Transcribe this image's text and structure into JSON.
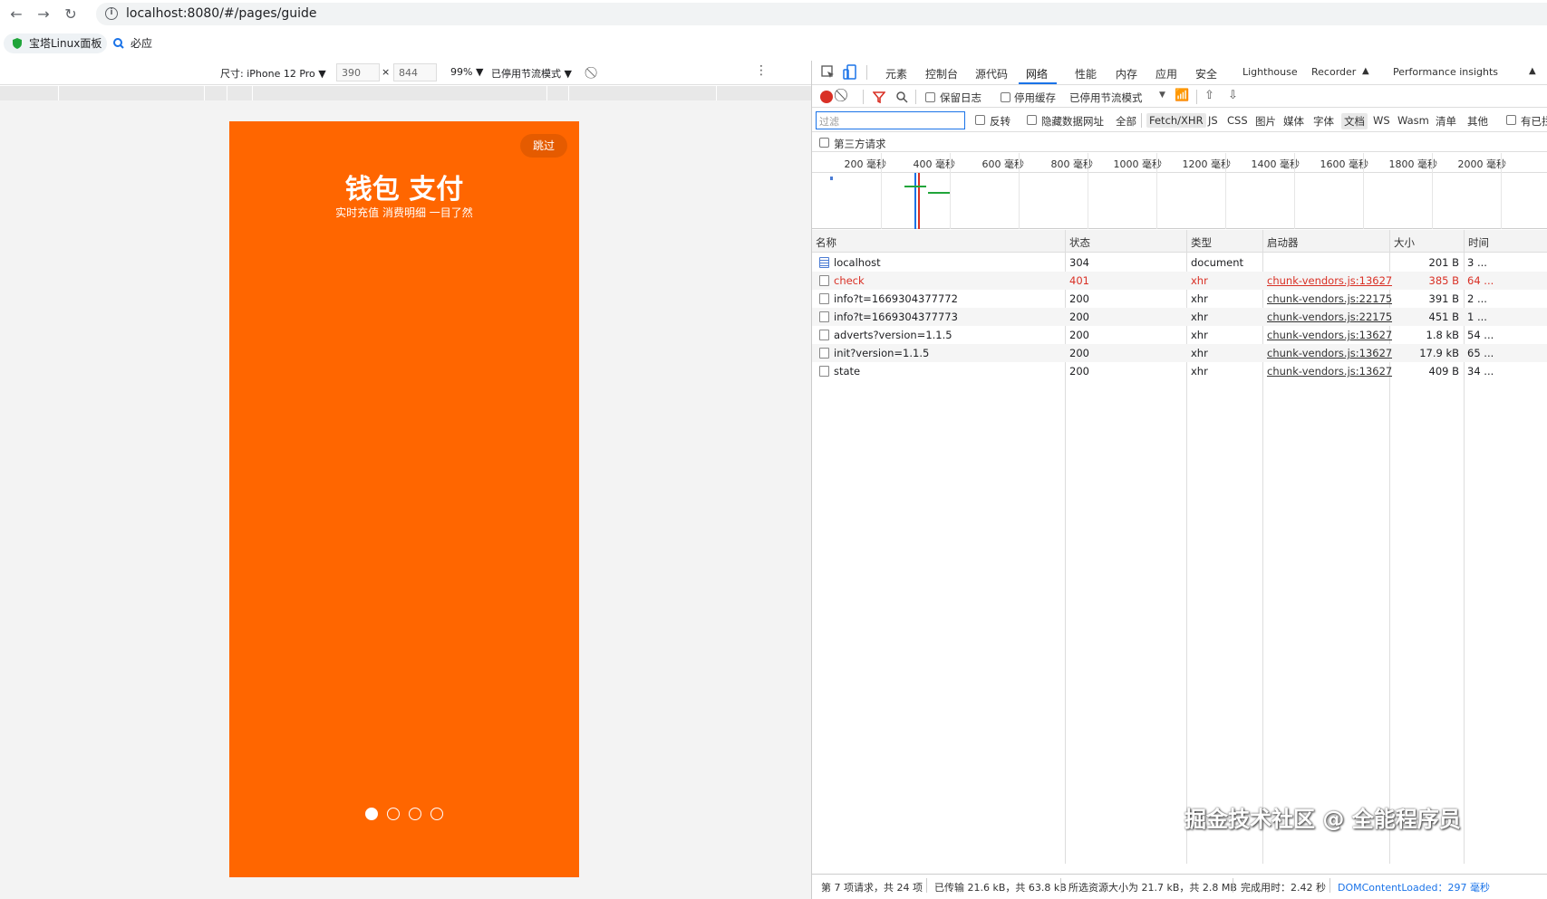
{
  "browser": {
    "url": "localhost:8080/#/pages/guide",
    "bookmarks": [
      {
        "label": "宝塔Linux面板"
      },
      {
        "label": "必应"
      }
    ]
  },
  "device_toolbar": {
    "dimensions_label": "尺寸: iPhone 12 Pro ▼",
    "width_value": "390",
    "times": "×",
    "height_value": "844",
    "zoom": "99% ▼",
    "throttle": "已停用节流模式 ▼"
  },
  "app": {
    "skip_label": "跳过",
    "title": "钱包 支付",
    "subtitle": "实时充值 消费明细 一目了然",
    "dots_total": 4,
    "dots_active_index": 0
  },
  "devtools": {
    "tabs": [
      "元素",
      "控制台",
      "源代码",
      "网络",
      "性能",
      "内存",
      "应用",
      "安全",
      "Lighthouse",
      "Recorder",
      "Performance insights"
    ],
    "active_tab": "网络",
    "network_toolbar": {
      "preserve_log": "保留日志",
      "disable_cache": "停用缓存",
      "throttle": "已停用节流模式"
    },
    "filter": {
      "placeholder": "过滤",
      "invert": "反转",
      "hide_data_urls": "隐藏数据网址",
      "types": [
        "全部",
        "Fetch/XHR",
        "JS",
        "CSS",
        "图片",
        "媒体",
        "字体",
        "文档",
        "WS",
        "Wasm",
        "清单",
        "其他"
      ],
      "blocked_cookies": "有已拦",
      "third_party": "第三方请求"
    },
    "timeline_ticks": [
      "200 毫秒",
      "400 毫秒",
      "600 毫秒",
      "800 毫秒",
      "1000 毫秒",
      "1200 毫秒",
      "1400 毫秒",
      "1600 毫秒",
      "1800 毫秒",
      "2000 毫秒"
    ],
    "columns": [
      "名称",
      "状态",
      "类型",
      "启动器",
      "大小",
      "时间"
    ],
    "rows": [
      {
        "name": "localhost",
        "status": "304",
        "type": "document",
        "initiator": "",
        "size": "201 B",
        "time": "3 ...",
        "error": false,
        "doc": true
      },
      {
        "name": "check",
        "status": "401",
        "type": "xhr",
        "initiator": "chunk-vendors.js:13627",
        "size": "385 B",
        "time": "64 ...",
        "error": true,
        "doc": false
      },
      {
        "name": "info?t=1669304377772",
        "status": "200",
        "type": "xhr",
        "initiator": "chunk-vendors.js:22175",
        "size": "391 B",
        "time": "2 ...",
        "error": false,
        "doc": false
      },
      {
        "name": "info?t=1669304377773",
        "status": "200",
        "type": "xhr",
        "initiator": "chunk-vendors.js:22175",
        "size": "451 B",
        "time": "1 ...",
        "error": false,
        "doc": false
      },
      {
        "name": "adverts?version=1.1.5",
        "status": "200",
        "type": "xhr",
        "initiator": "chunk-vendors.js:13627",
        "size": "1.8 kB",
        "time": "54 ...",
        "error": false,
        "doc": false
      },
      {
        "name": "init?version=1.1.5",
        "status": "200",
        "type": "xhr",
        "initiator": "chunk-vendors.js:13627",
        "size": "17.9 kB",
        "time": "65 ...",
        "error": false,
        "doc": false
      },
      {
        "name": "state",
        "status": "200",
        "type": "xhr",
        "initiator": "chunk-vendors.js:13627",
        "size": "409 B",
        "time": "34 ...",
        "error": false,
        "doc": false
      }
    ],
    "status_bar": {
      "requests": "第 7 项请求，共 24 项",
      "transferred": "已传输 21.6 kB，共 63.8 kB",
      "resources": "所选资源大小为 21.7 kB，共 2.8 MB",
      "finish": "完成用时：2.42 秒",
      "dcl": "DOMContentLoaded：297 毫秒"
    }
  },
  "watermark": "掘金技术社区 @ 全能程序员",
  "colors": {
    "app_bg": "#ff6600",
    "accent": "#1a73e8",
    "error": "#d93025",
    "record": "#d93025"
  }
}
